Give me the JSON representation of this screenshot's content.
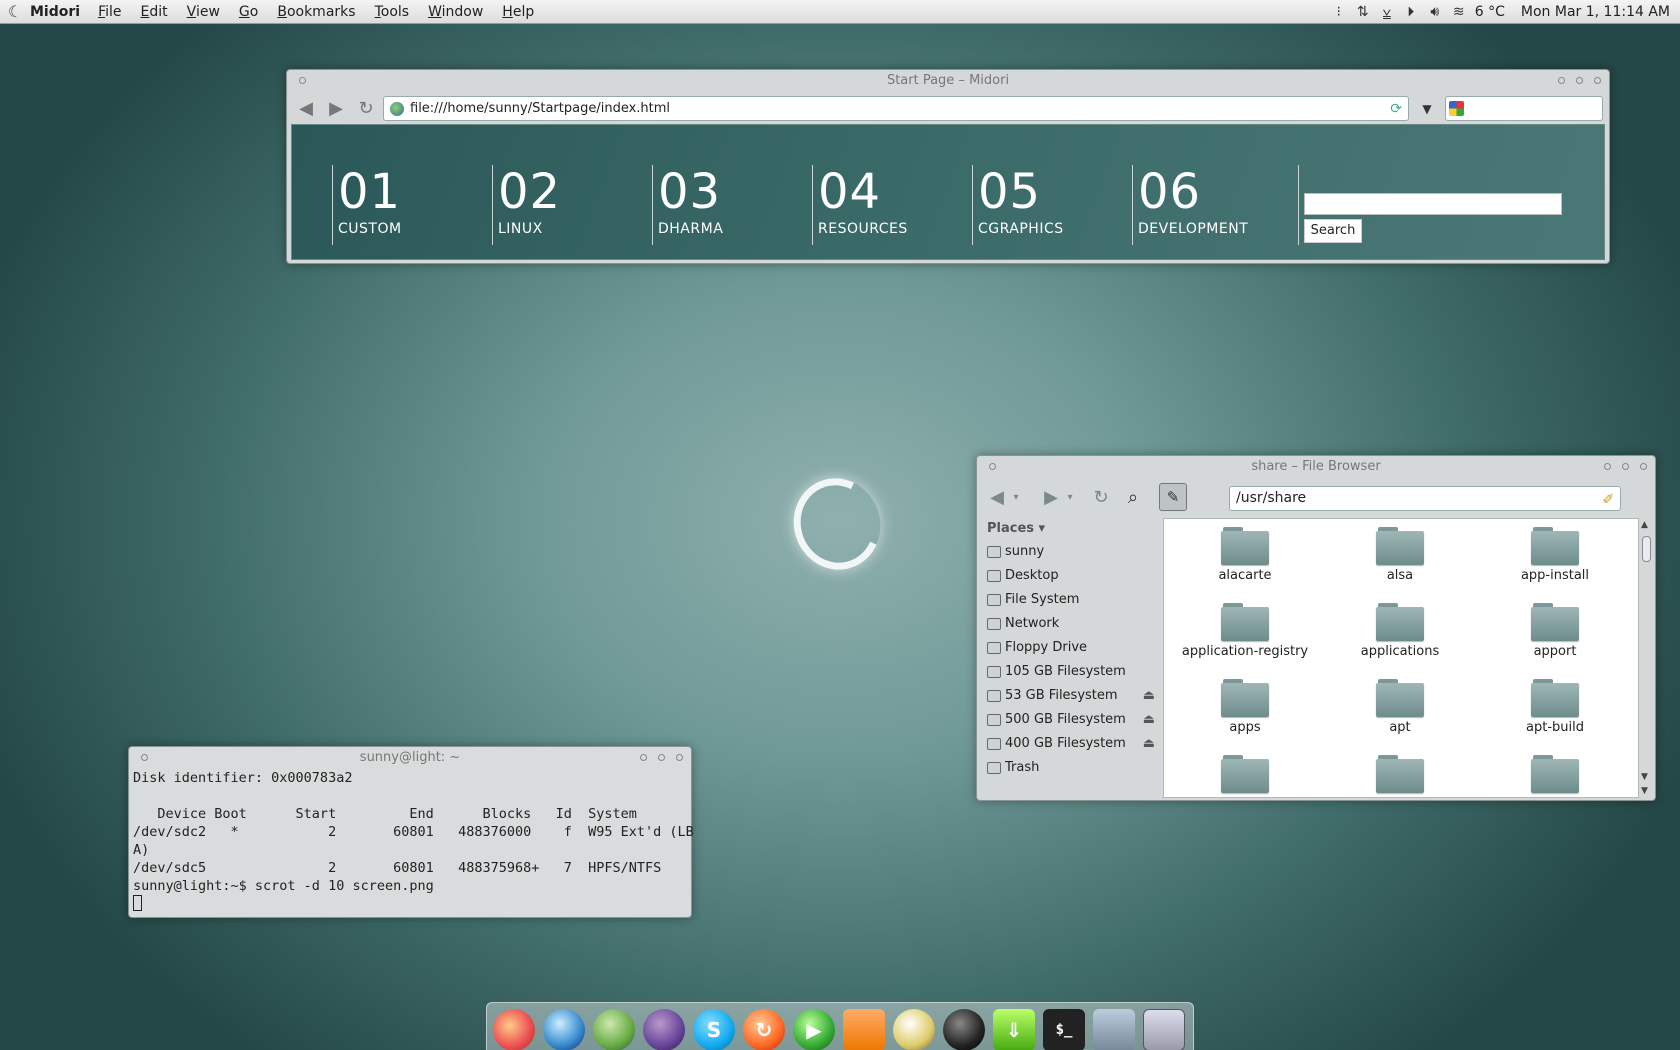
{
  "topbar": {
    "app_name": "Midori",
    "menus": [
      "File",
      "Edit",
      "View",
      "Go",
      "Bookmarks",
      "Tools",
      "Window",
      "Help"
    ],
    "weather": "6 °C",
    "clock": "Mon Mar  1, 11:14 AM"
  },
  "browser": {
    "title": "Start Page – Midori",
    "url": "file:///home/sunny/Startpage/index.html",
    "search_value": "",
    "tiles": [
      {
        "num": "01",
        "label": "CUSTOM"
      },
      {
        "num": "02",
        "label": "LINUX"
      },
      {
        "num": "03",
        "label": "DHARMA"
      },
      {
        "num": "04",
        "label": "RESOURCES"
      },
      {
        "num": "05",
        "label": "CGRAPHICS"
      },
      {
        "num": "06",
        "label": "DEVELOPMENT"
      }
    ],
    "search_button": "Search"
  },
  "filebrowser": {
    "title": "share – File Browser",
    "path": "/usr/share",
    "places_header": "Places",
    "places": [
      {
        "label": "sunny",
        "eject": false
      },
      {
        "label": "Desktop",
        "eject": false
      },
      {
        "label": "File System",
        "eject": false
      },
      {
        "label": "Network",
        "eject": false
      },
      {
        "label": "Floppy Drive",
        "eject": false
      },
      {
        "label": "105 GB Filesystem",
        "eject": false
      },
      {
        "label": "53 GB Filesystem",
        "eject": true
      },
      {
        "label": "500 GB Filesystem",
        "eject": true
      },
      {
        "label": "400 GB Filesystem",
        "eject": true
      },
      {
        "label": "Trash",
        "eject": false
      }
    ],
    "folders": [
      "alacarte",
      "alsa",
      "app-install",
      "application-registry",
      "applications",
      "apport",
      "apps",
      "apt",
      "apt-build",
      "",
      "",
      ""
    ]
  },
  "terminal": {
    "title": "sunny@light: ~",
    "lines": [
      "Disk identifier: 0x000783a2",
      "",
      "   Device Boot      Start         End      Blocks   Id  System",
      "/dev/sdc2   *           2       60801   488376000    f  W95 Ext'd (LB",
      "A)",
      "/dev/sdc5               2       60801   488375968+   7  HPFS/NTFS",
      "sunny@light:~$ scrot -d 10 screen.png"
    ]
  },
  "dock": {
    "items": [
      "firefox-icon",
      "web-browser-icon",
      "midori-icon",
      "pidgin-icon",
      "skype-icon",
      "update-icon",
      "media-player-icon",
      "vlc-icon",
      "panda-icon",
      "inkscape-icon",
      "download-icon",
      "terminal-icon",
      "file-manager-icon",
      "workspace-switcher-icon"
    ]
  }
}
